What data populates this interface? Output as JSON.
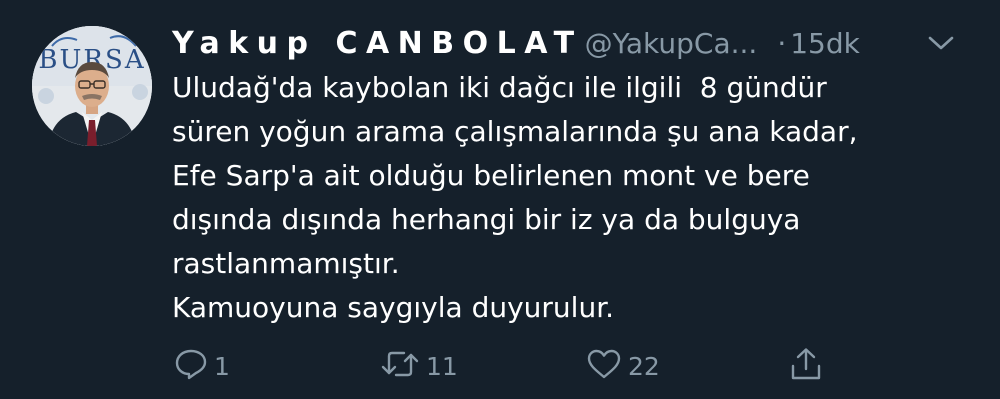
{
  "tweet": {
    "display_name": "Yakup CANBOLAT",
    "handle": "@YakupCa...",
    "separator": "·",
    "time": "15dk",
    "text_lines": [
      "Uludağ'da kaybolan iki dağcı ile ilgili  8 gündür",
      "süren yoğun arama çalışmalarında şu ana kadar,",
      "Efe Sarp'a ait olduğu belirlenen mont ve bere",
      "dışında dışında herhangi bir iz ya da bulguya",
      "rastlanmamıştır.",
      "Kamuoyuna saygıyla duyurulur."
    ],
    "actions": {
      "reply_count": "1",
      "retweet_count": "11",
      "like_count": "22"
    }
  },
  "icons": {
    "reply": "reply-icon",
    "retweet": "retweet-icon",
    "like": "heart-icon",
    "share": "share-icon",
    "more": "chevron-down-icon"
  },
  "colors": {
    "background": "#15202b",
    "primary_text": "#ffffff",
    "secondary_text": "#8899a6"
  },
  "avatar": {
    "backdrop_text": "BURSA"
  }
}
